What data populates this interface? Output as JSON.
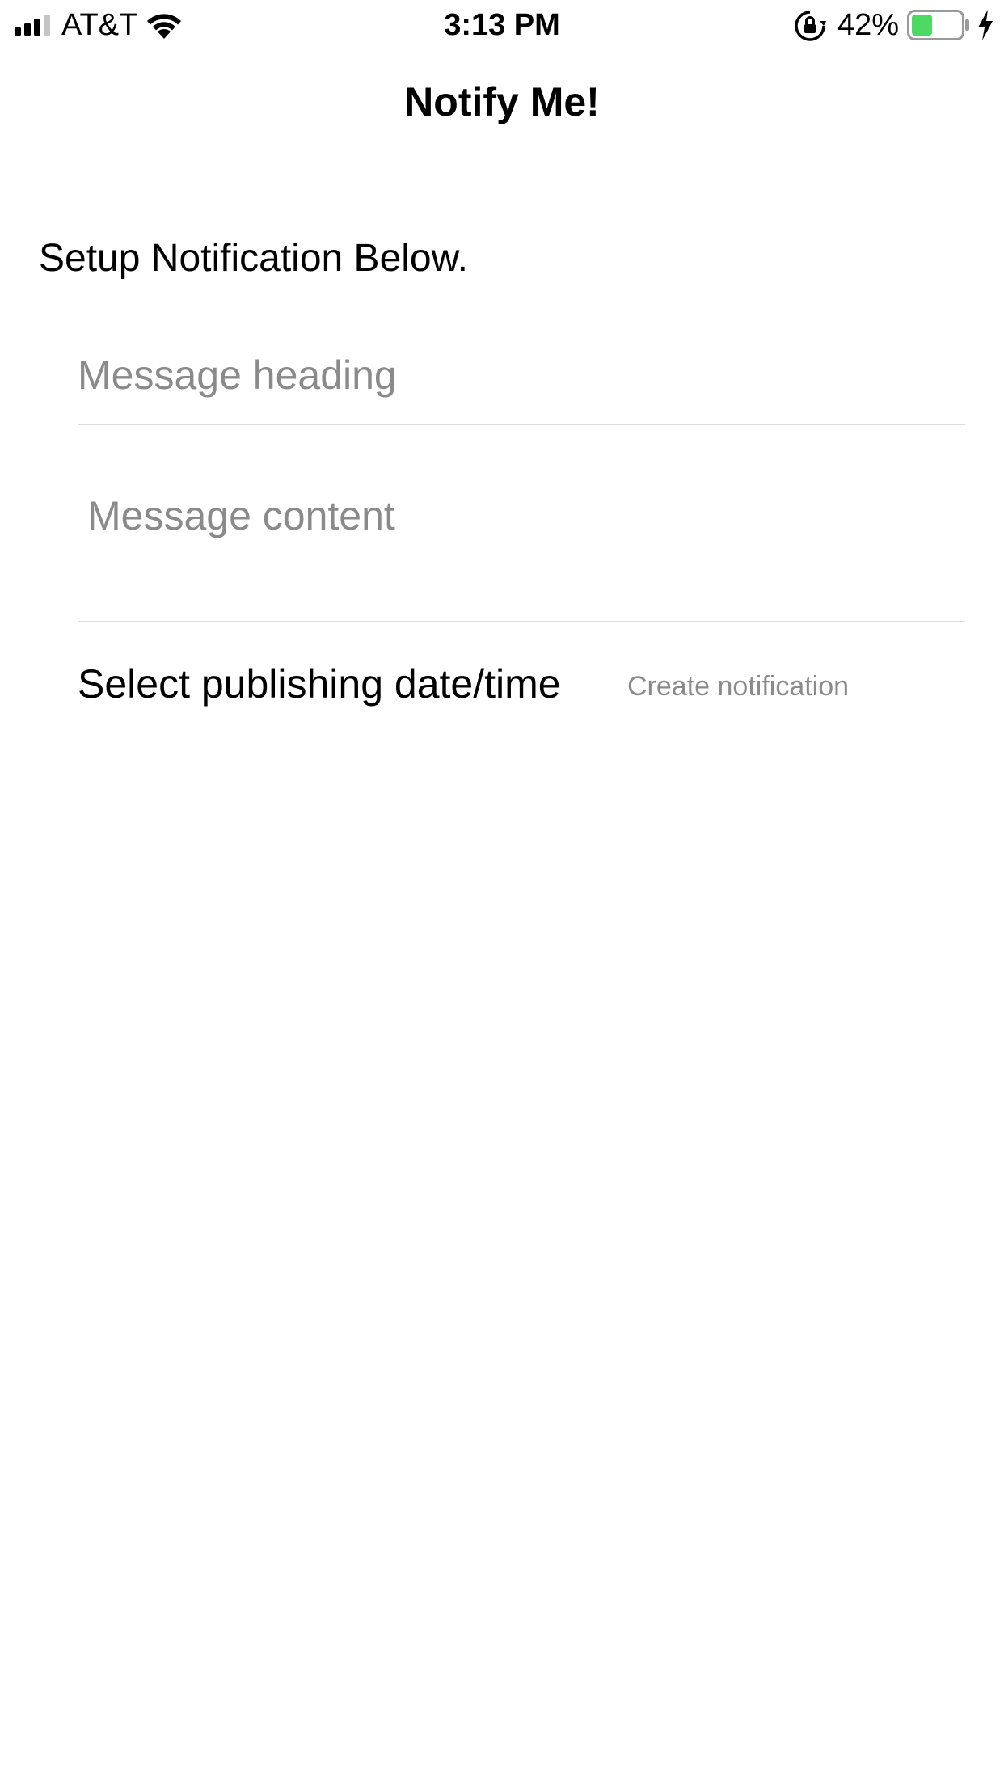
{
  "status_bar": {
    "carrier": "AT&T",
    "time": "3:13 PM",
    "battery_percent": "42%",
    "battery_level": 0.42,
    "battery_fill_color": "#4cd964",
    "icons": [
      "signal-icon",
      "wifi-icon",
      "rotation-lock-icon",
      "battery-icon",
      "charging-bolt-icon"
    ]
  },
  "nav": {
    "title": "Notify Me!"
  },
  "form": {
    "instruction": "Setup Notification Below.",
    "heading_placeholder": "Message heading",
    "heading_value": "",
    "content_placeholder": "Message content",
    "content_value": "",
    "date_label": "Select publishing date/time",
    "create_label": "Create notification"
  },
  "colors": {
    "placeholder": "#8a8a8a",
    "divider": "#dcdcdc",
    "text": "#000000"
  }
}
